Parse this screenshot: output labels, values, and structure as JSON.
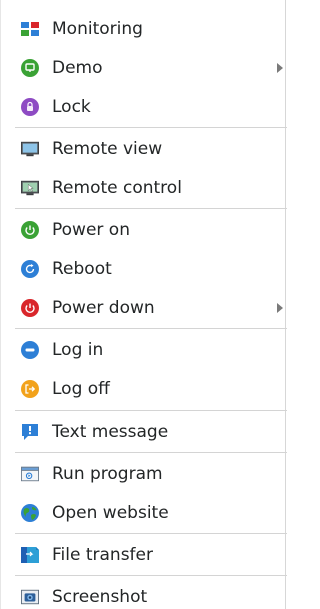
{
  "menu": {
    "items": [
      {
        "label": "Monitoring",
        "icon": "monitoring-grid-icon"
      },
      {
        "label": "Demo",
        "icon": "demo-screen-icon",
        "submenu": true
      },
      {
        "label": "Lock",
        "icon": "lock-icon"
      },
      {
        "label": "Remote view",
        "icon": "remote-view-monitor-icon"
      },
      {
        "label": "Remote control",
        "icon": "remote-control-monitor-icon"
      },
      {
        "label": "Power on",
        "icon": "power-on-icon"
      },
      {
        "label": "Reboot",
        "icon": "reboot-icon"
      },
      {
        "label": "Power down",
        "icon": "power-down-icon",
        "submenu": true
      },
      {
        "label": "Log in",
        "icon": "log-in-icon"
      },
      {
        "label": "Log off",
        "icon": "log-off-icon"
      },
      {
        "label": "Text message",
        "icon": "text-message-icon"
      },
      {
        "label": "Run program",
        "icon": "run-program-icon"
      },
      {
        "label": "Open website",
        "icon": "globe-icon"
      },
      {
        "label": "File transfer",
        "icon": "file-transfer-icon"
      },
      {
        "label": "Screenshot",
        "icon": "screenshot-camera-icon"
      }
    ]
  },
  "colors": {
    "separator": "#d4d4d4",
    "text": "#232627",
    "green": "#3aa235",
    "purple": "#8e4bc3",
    "blue": "#2d7fd6",
    "red": "#d9262b",
    "orange": "#f2a21b"
  }
}
